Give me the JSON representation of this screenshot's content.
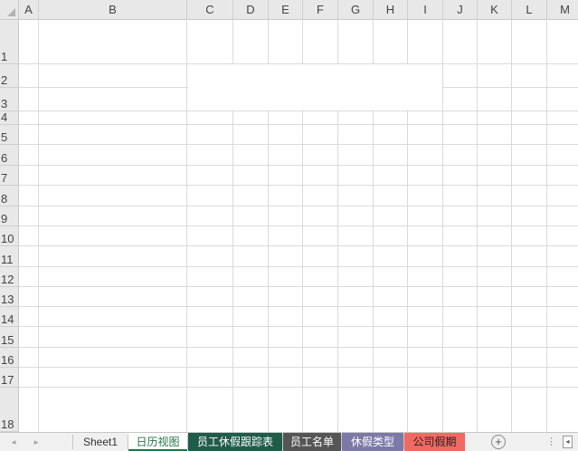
{
  "columns": [
    "A",
    "B",
    "C",
    "D",
    "E",
    "F",
    "G",
    "H",
    "I",
    "J",
    "K",
    "L",
    "M"
  ],
  "rows": [
    "1",
    "2",
    "3",
    "4",
    "5",
    "6",
    "7",
    "8",
    "9",
    "10",
    "11",
    "12",
    "13",
    "14",
    "15",
    "16",
    "17",
    "18"
  ],
  "sheet_tabs": [
    {
      "label": "Sheet1",
      "color": "",
      "text_color": "#333333",
      "active": false
    },
    {
      "label": "日历视图",
      "color": "#ffffff",
      "text_color": "#217346",
      "active": true
    },
    {
      "label": "员工休假跟踪表",
      "color": "#1f5c4a",
      "text_color": "#ffffff",
      "active": false
    },
    {
      "label": "员工名单",
      "color": "#555555",
      "text_color": "#ffffff",
      "active": false
    },
    {
      "label": "休假类型",
      "color": "#7b79a6",
      "text_color": "#ffffff",
      "active": false
    },
    {
      "label": "公司假期",
      "color": "#ef6a62",
      "text_color": "#222222",
      "active": false
    }
  ],
  "icons": {
    "prev": "◂",
    "next": "▸",
    "add": "+",
    "more": "⋮",
    "scroll_left": "◂"
  }
}
